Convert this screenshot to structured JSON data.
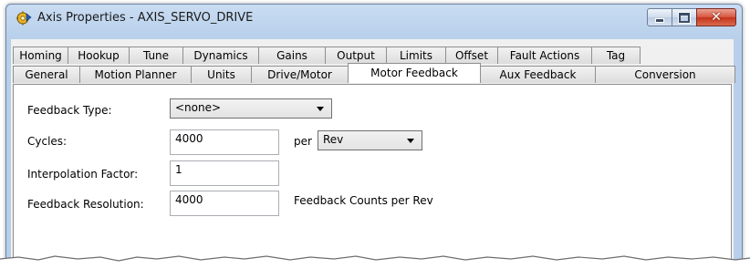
{
  "window": {
    "title": "Axis Properties - AXIS_SERVO_DRIVE",
    "app_icon": "motion-gear-icon",
    "controls": [
      "minimize-icon",
      "maximize-icon",
      "close-icon"
    ]
  },
  "tabs": {
    "back_row": [
      {
        "label": "Homing"
      },
      {
        "label": "Hookup"
      },
      {
        "label": "Tune"
      },
      {
        "label": "Dynamics"
      },
      {
        "label": "Gains"
      },
      {
        "label": "Output"
      },
      {
        "label": "Limits"
      },
      {
        "label": "Offset"
      },
      {
        "label": "Fault Actions"
      },
      {
        "label": "Tag"
      }
    ],
    "front_row": [
      {
        "label": "General"
      },
      {
        "label": "Motion Planner"
      },
      {
        "label": "Units"
      },
      {
        "label": "Drive/Motor"
      },
      {
        "label": "Motor Feedback",
        "active": true
      },
      {
        "label": "Aux Feedback"
      },
      {
        "label": "Conversion"
      }
    ]
  },
  "form": {
    "feedback_type": {
      "label": "Feedback Type:",
      "value": "<none>"
    },
    "cycles": {
      "label": "Cycles:",
      "value": "4000",
      "per_label": "per",
      "unit_value": "Rev"
    },
    "interpolation_factor": {
      "label": "Interpolation Factor:",
      "value": "1"
    },
    "feedback_resolution": {
      "label": "Feedback Resolution:",
      "value": "4000",
      "suffix": "Feedback Counts per Rev"
    }
  }
}
